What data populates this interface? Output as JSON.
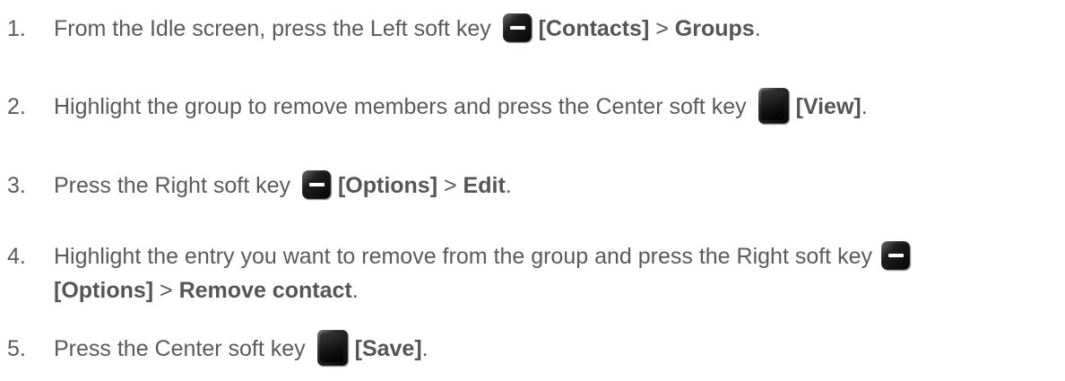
{
  "steps": [
    {
      "number": "1.",
      "pre": "From the Idle screen, press the Left soft key ",
      "bold1": "[Contacts]",
      "mid": " > ",
      "bold2": "Groups",
      "post": "."
    },
    {
      "number": "2.",
      "pre": "Highlight the group to remove members and press the Center soft key ",
      "bold1": "[View]",
      "post": "."
    },
    {
      "number": "3.",
      "pre": "Press the Right soft key ",
      "bold1": "[Options]",
      "mid": " > ",
      "bold2": "Edit",
      "post": "."
    },
    {
      "number": "4.",
      "pre": "Highlight the entry you want to remove from the group and press the Right soft key",
      "bold1": "[Options]",
      "mid": " > ",
      "bold2": "Remove contact",
      "post": "."
    },
    {
      "number": "5.",
      "pre": "Press the Center soft key ",
      "bold1": "[Save]",
      "post": "."
    }
  ],
  "icons": {
    "soft_key": "soft-key-icon",
    "center_key": "center-key-icon"
  }
}
